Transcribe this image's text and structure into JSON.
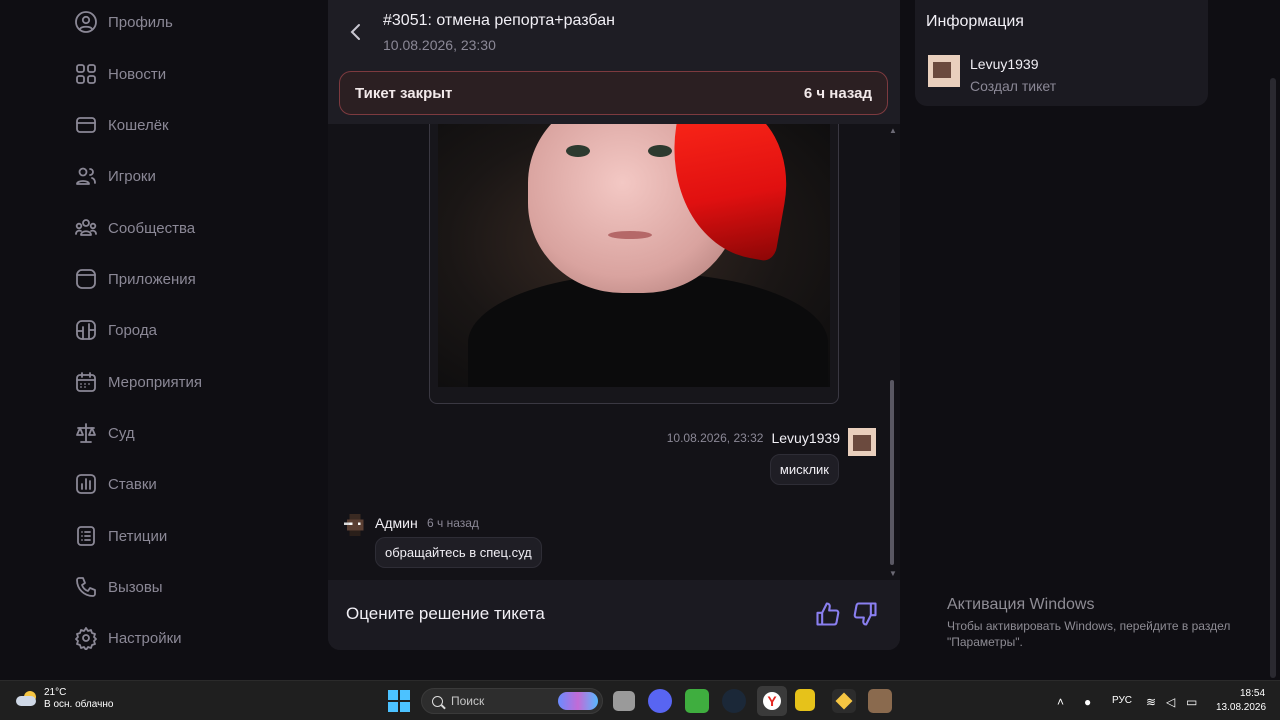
{
  "sidebar": {
    "items": [
      {
        "label": "Профиль",
        "icon": "user-icon"
      },
      {
        "label": "Новости",
        "icon": "grid-icon"
      },
      {
        "label": "Кошелёк",
        "icon": "wallet-icon"
      },
      {
        "label": "Игроки",
        "icon": "users-icon"
      },
      {
        "label": "Сообщества",
        "icon": "community-icon"
      },
      {
        "label": "Приложения",
        "icon": "apps-icon"
      },
      {
        "label": "Города",
        "icon": "city-icon"
      },
      {
        "label": "Мероприятия",
        "icon": "calendar-icon"
      },
      {
        "label": "Суд",
        "icon": "scales-icon"
      },
      {
        "label": "Ставки",
        "icon": "chart-icon"
      },
      {
        "label": "Петиции",
        "icon": "list-icon"
      },
      {
        "label": "Вызовы",
        "icon": "phone-icon"
      },
      {
        "label": "Настройки",
        "icon": "gear-icon"
      }
    ]
  },
  "ticket": {
    "title": "#3051: отмена репорта+разбан",
    "date": "10.08.2026, 23:30",
    "status_label": "Тикет закрыт",
    "status_ago": "6 ч назад"
  },
  "messages": {
    "user_msg": {
      "time": "10.08.2026, 23:32",
      "author": "Levuy1939",
      "text": "мисклик"
    },
    "admin_msg": {
      "author": "Админ",
      "time": "6 ч назад",
      "text": "обращайтесь в спец.суд"
    }
  },
  "rating": {
    "label": "Оцените решение тикета"
  },
  "info": {
    "title": "Информация",
    "user_name": "Levuy1939",
    "user_role": "Создал тикет"
  },
  "watermark": {
    "title": "Активация Windows",
    "subtitle": "Чтобы активировать Windows, перейдите в раздел \"Параметры\"."
  },
  "taskbar": {
    "weather_temp": "21°C",
    "weather_desc": "В осн. облачно",
    "search_placeholder": "Поиск",
    "lang": "РУС",
    "time": "18:54",
    "date": "13.08.2026"
  },
  "colors": {
    "accent": "#8a7ff0",
    "closed_border": "#7d3a3f",
    "panel_bg": "#1b1a21"
  }
}
